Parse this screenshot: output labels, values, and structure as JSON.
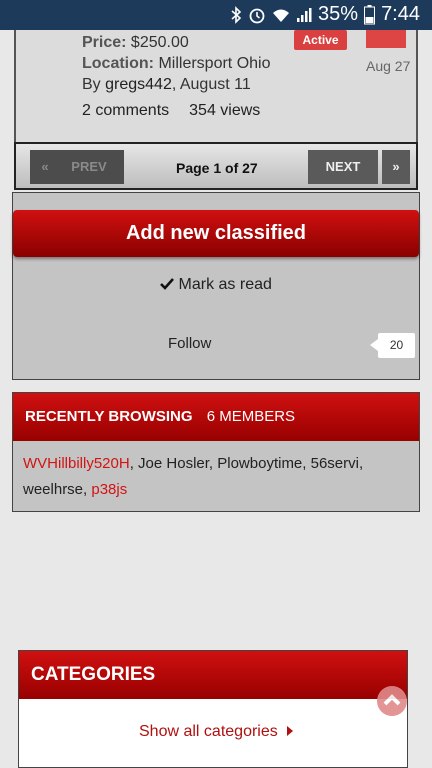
{
  "status_bar": {
    "battery": "35%",
    "time": "7:44"
  },
  "listing": {
    "price_label": "Price:",
    "price": "$250.00",
    "location_label": "Location:",
    "location": "Millersport Ohio",
    "by_prefix": "By",
    "author": "gregs442",
    "posted": ", August 11",
    "comments": "2 comments",
    "views": "354 views",
    "badge": "Active",
    "date": "Aug 27"
  },
  "pager": {
    "prev": "PREV",
    "next": "NEXT",
    "page": "Page 1 of 27",
    "first_icon": "«",
    "last_icon": "»"
  },
  "actions": {
    "add": "Add new classified",
    "mark_read": "Mark as read",
    "follow": "Follow",
    "follow_count": "20"
  },
  "browsing": {
    "title": "RECENTLY BROWSING",
    "count": "6 MEMBERS",
    "members_line1_red": "WVHillbilly520H",
    "members_line1_rest": ", Joe Hosler, Plowboytime, 56servi,",
    "members_line2": "weelhrse, ",
    "members_line2_red": "p38js"
  },
  "categories": {
    "title": "CATEGORIES",
    "show_all": "Show all categories"
  }
}
